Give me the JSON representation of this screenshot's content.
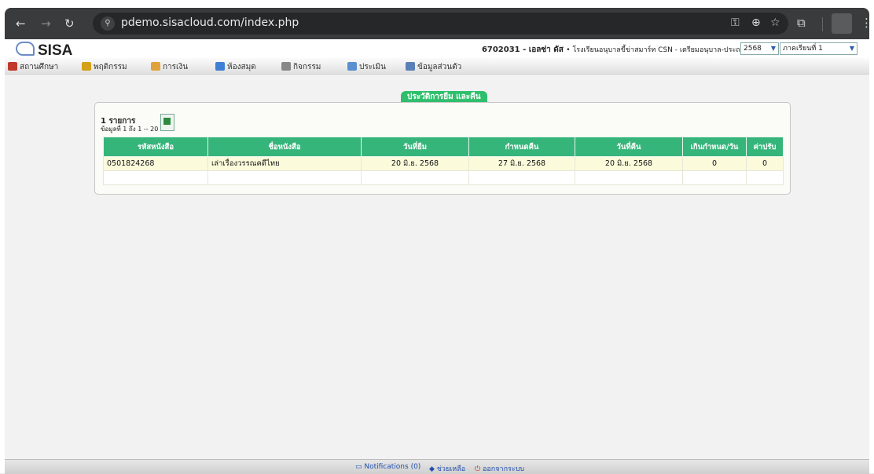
{
  "browser": {
    "url": "pdemo.sisacloud.com/index.php",
    "back": "←",
    "forward": "→",
    "reload": "↻",
    "tune": "⚲",
    "key": "⚿",
    "zoom": "⊕",
    "star": "☆",
    "ext": "⧉",
    "menu": "⋮"
  },
  "header": {
    "logo": "SISA",
    "user_id": "6702031",
    "user_name": " - เอลซ่า ดัส ",
    "school": "• โรงเรียนอนุบาลขี้ข่าสมาร์ท CSN - เตรียมอนุบาล-ประถมศึกษา •",
    "year": "2568",
    "term": "ภาคเรียนที่ 1"
  },
  "menu": [
    "สถานศึกษา",
    "พฤติกรรม",
    "การเงิน",
    "ห้องสมุด",
    "กิจกรรม",
    "ประเมิน",
    "ข้อมูลส่วนตัว"
  ],
  "section_title": "ประวัติการยืม และคืน",
  "summary": {
    "count": "1 รายการ",
    "range": "ข้อมูลที่ 1 ถึง 1 -- 20"
  },
  "table": {
    "headers": [
      "รหัสหนังสือ",
      "ชื่อหนังสือ",
      "วันที่ยืม",
      "กำหนดคืน",
      "วันที่คืน",
      "เกินกำหนด/วัน",
      "ค่าปรับ"
    ],
    "rows": [
      [
        "0501824268",
        "เล่าเรื่องวรรณคดีไทย",
        "20 มิ.ย. 2568",
        "27 มิ.ย. 2568",
        "20 มิ.ย. 2568",
        "0",
        "0"
      ]
    ]
  },
  "footer": {
    "notifications": "Notifications (0)",
    "help": "ช่วยเหลือ",
    "logout": "ออกจากระบบ"
  },
  "colors": {
    "accent": "#36b57a",
    "tab": "#2fbf6c",
    "row": "#fbfbdc"
  }
}
